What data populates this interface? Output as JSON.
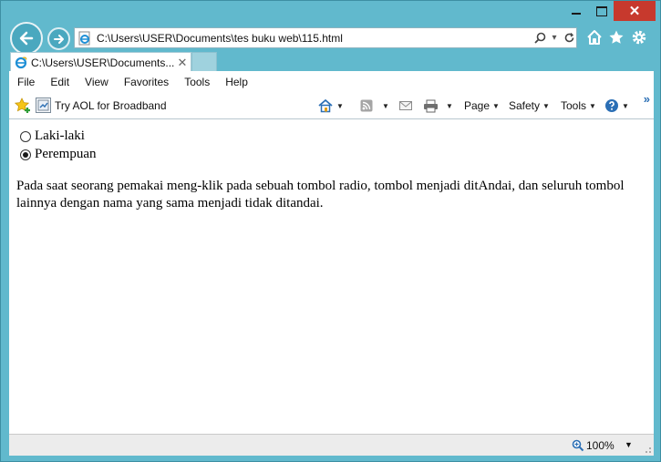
{
  "window": {
    "close_glyph": "✕"
  },
  "address": {
    "url": "C:\\Users\\USER\\Documents\\tes buku web\\115.html"
  },
  "tab": {
    "title": "C:\\Users\\USER\\Documents...",
    "close_glyph": "✕"
  },
  "menu": [
    "File",
    "Edit",
    "View",
    "Favorites",
    "Tools",
    "Help"
  ],
  "favorites_bar": {
    "link_label": "Try AOL for Broadband"
  },
  "command_bar": {
    "page_label": "Page",
    "safety_label": "Safety",
    "tools_label": "Tools",
    "chevrons": "»"
  },
  "content": {
    "radio_options": [
      {
        "label": "Laki-laki",
        "checked": false
      },
      {
        "label": "Perempuan",
        "checked": true
      }
    ],
    "paragraph": "Pada saat seorang pemakai meng-klik pada sebuah tombol radio, tombol menjadi ditAndai, dan seluruh tombol lainnya dengan nama yang sama menjadi tidak ditandai."
  },
  "status_bar": {
    "zoom": "100%"
  },
  "colors": {
    "frame": "#61b9cd",
    "close_button": "#c7392d",
    "accent": "#2b6fb5"
  }
}
